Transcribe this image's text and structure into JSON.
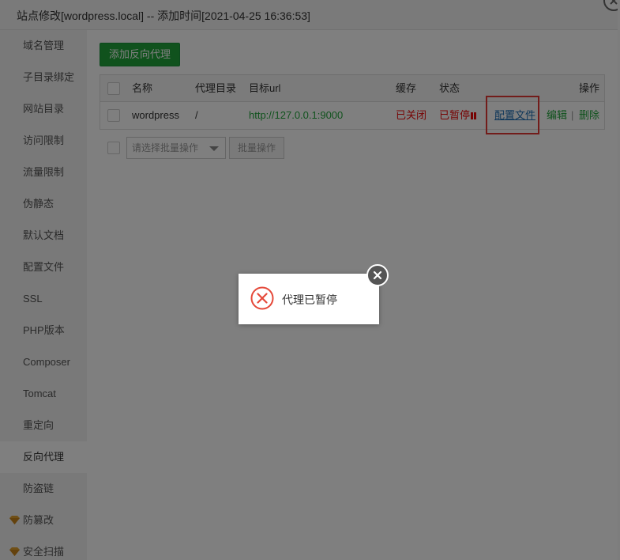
{
  "window": {
    "title": "站点修改[wordpress.local] -- 添加时间[2021-04-25 16:36:53]"
  },
  "sidebar": {
    "items": [
      {
        "label": "域名管理",
        "vip": false
      },
      {
        "label": "子目录绑定",
        "vip": false
      },
      {
        "label": "网站目录",
        "vip": false
      },
      {
        "label": "访问限制",
        "vip": false
      },
      {
        "label": "流量限制",
        "vip": false
      },
      {
        "label": "伪静态",
        "vip": false
      },
      {
        "label": "默认文档",
        "vip": false
      },
      {
        "label": "配置文件",
        "vip": false
      },
      {
        "label": "SSL",
        "vip": false
      },
      {
        "label": "PHP版本",
        "vip": false
      },
      {
        "label": "Composer",
        "vip": false
      },
      {
        "label": "Tomcat",
        "vip": false
      },
      {
        "label": "重定向",
        "vip": false
      },
      {
        "label": "反向代理",
        "vip": false,
        "active": true
      },
      {
        "label": "防盗链",
        "vip": false
      },
      {
        "label": "防篡改",
        "vip": true
      },
      {
        "label": "安全扫描",
        "vip": true
      }
    ]
  },
  "main": {
    "add_button": "添加反向代理",
    "table": {
      "headers": {
        "name": "名称",
        "dir": "代理目录",
        "url": "目标url",
        "cache": "缓存",
        "status": "状态",
        "ops": "操作"
      },
      "rows": [
        {
          "name": "wordpress",
          "dir": "/",
          "url": "http://127.0.0.1:9000",
          "cache": "已关闭",
          "status": "已暂停",
          "config": "配置文件",
          "edit": "编辑",
          "sep": "|",
          "delete": "删除"
        }
      ]
    },
    "batch": {
      "select_placeholder": "请选择批量操作",
      "button": "批量操作"
    }
  },
  "toast": {
    "message": "代理已暂停"
  },
  "colors": {
    "accent_green": "#20a53a",
    "status_red": "#ef0808",
    "link_blue": "#1e6fb5",
    "highlight_red": "#e53935"
  }
}
